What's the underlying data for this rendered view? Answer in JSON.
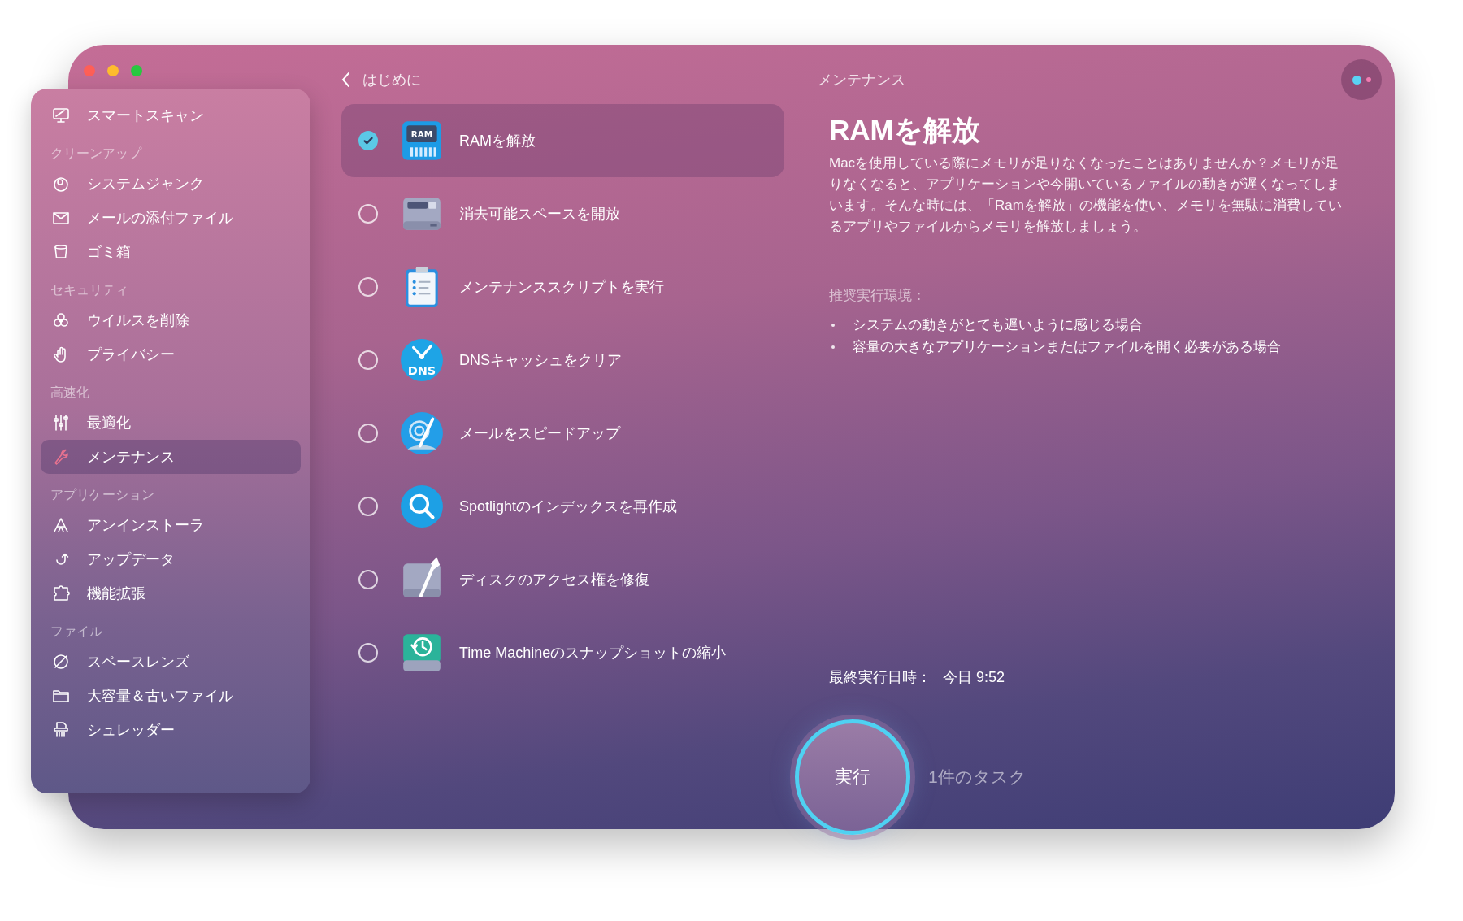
{
  "window": {
    "title": "メンテナンス",
    "back": "はじめに"
  },
  "sidebar": {
    "entries": [
      {
        "kind": "item",
        "label": "スマートスキャン",
        "selected": false
      },
      {
        "kind": "header",
        "label": "クリーンアップ"
      },
      {
        "kind": "item",
        "label": "システムジャンク",
        "selected": false
      },
      {
        "kind": "item",
        "label": "メールの添付ファイル",
        "selected": false
      },
      {
        "kind": "item",
        "label": "ゴミ箱",
        "selected": false
      },
      {
        "kind": "header",
        "label": "セキュリティ"
      },
      {
        "kind": "item",
        "label": "ウイルスを削除",
        "selected": false
      },
      {
        "kind": "item",
        "label": "プライバシー",
        "selected": false
      },
      {
        "kind": "header",
        "label": "高速化"
      },
      {
        "kind": "item",
        "label": "最適化",
        "selected": false
      },
      {
        "kind": "item",
        "label": "メンテナンス",
        "selected": true
      },
      {
        "kind": "header",
        "label": "アプリケーション"
      },
      {
        "kind": "item",
        "label": "アンインストーラ",
        "selected": false
      },
      {
        "kind": "item",
        "label": "アップデータ",
        "selected": false
      },
      {
        "kind": "item",
        "label": "機能拡張",
        "selected": false
      },
      {
        "kind": "header",
        "label": "ファイル"
      },
      {
        "kind": "item",
        "label": "スペースレンズ",
        "selected": false
      },
      {
        "kind": "item",
        "label": "大容量＆古いファイル",
        "selected": false
      },
      {
        "kind": "item",
        "label": "シュレッダー",
        "selected": false
      }
    ]
  },
  "tasks": [
    {
      "label": "RAMを解放",
      "icon_text": "RAM",
      "checked": true,
      "selected": true
    },
    {
      "label": "消去可能スペースを開放",
      "checked": false,
      "selected": false
    },
    {
      "label": "メンテナンススクリプトを実行",
      "checked": false,
      "selected": false
    },
    {
      "label": "DNSキャッシュをクリア",
      "icon_text": "DNS",
      "checked": false,
      "selected": false
    },
    {
      "label": "メールをスピードアップ",
      "checked": false,
      "selected": false
    },
    {
      "label": "Spotlightのインデックスを再作成",
      "checked": false,
      "selected": false
    },
    {
      "label": "ディスクのアクセス権を修復",
      "checked": false,
      "selected": false
    },
    {
      "label": "Time Machineのスナップショットの縮小",
      "checked": false,
      "selected": false
    }
  ],
  "details": {
    "title": "RAMを解放",
    "description": "Macを使用している際にメモリが足りなくなったことはありませんか？メモリが足りなくなると、アプリケーションや今開いているファイルの動きが遅くなってしまいます。そんな時には、「Ramを解放」の機能を使い、メモリを無駄に消費しているアプリやファイルからメモリを解放しましょう。",
    "recommended_label": "推奨実行環境：",
    "recommended": [
      "システムの動きがとても遅いように感じる場合",
      "容量の大きなアプリケーションまたはファイルを開く必要がある場合"
    ],
    "last_run_label": "最終実行日時：",
    "last_run_value": "今日 9:52"
  },
  "run": {
    "label": "実行",
    "task_count": "1件のタスク"
  }
}
